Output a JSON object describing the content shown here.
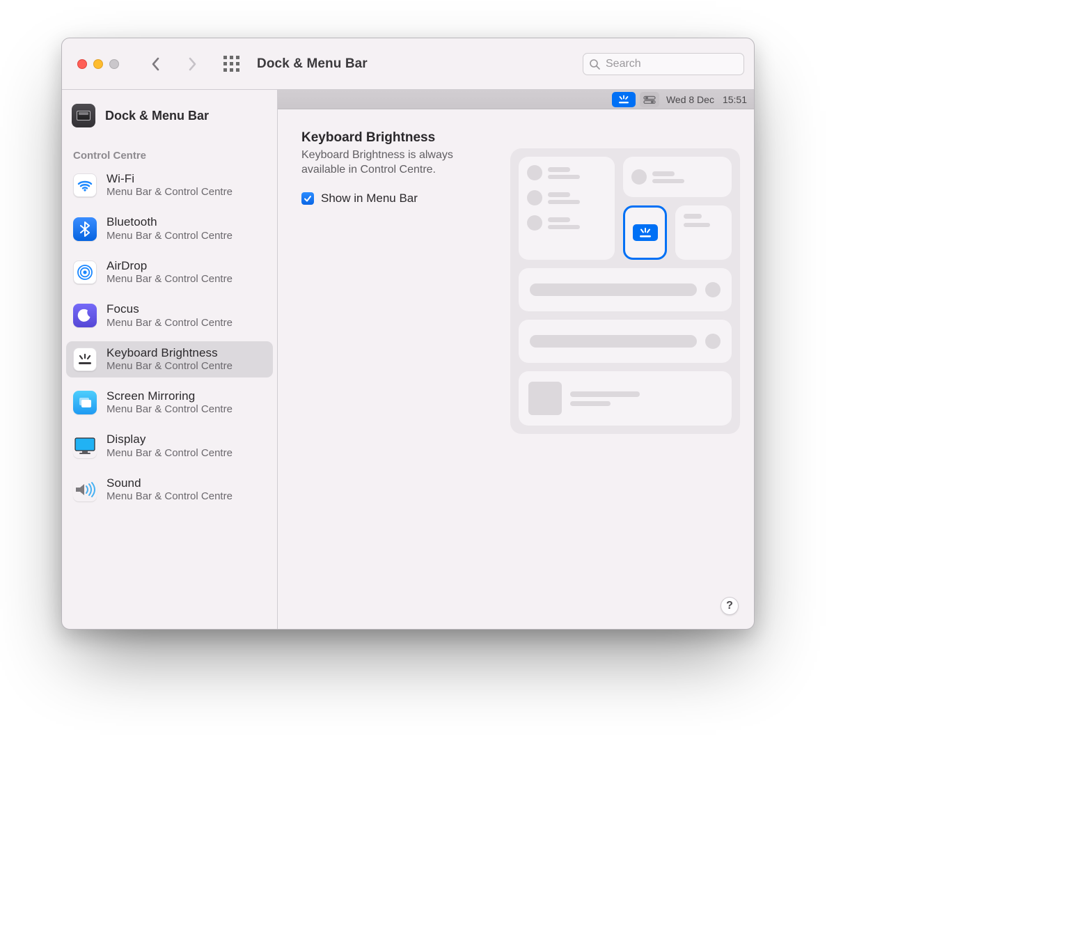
{
  "toolbar": {
    "title": "Dock & Menu Bar",
    "search_placeholder": "Search"
  },
  "sidebar": {
    "header": "Dock & Menu Bar",
    "section": "Control Centre",
    "items": [
      {
        "label": "Wi-Fi",
        "sub": "Menu Bar & Control Centre"
      },
      {
        "label": "Bluetooth",
        "sub": "Menu Bar & Control Centre"
      },
      {
        "label": "AirDrop",
        "sub": "Menu Bar & Control Centre"
      },
      {
        "label": "Focus",
        "sub": "Menu Bar & Control Centre"
      },
      {
        "label": "Keyboard Brightness",
        "sub": "Menu Bar & Control Centre"
      },
      {
        "label": "Screen Mirroring",
        "sub": "Menu Bar & Control Centre"
      },
      {
        "label": "Display",
        "sub": "Menu Bar & Control Centre"
      },
      {
        "label": "Sound",
        "sub": "Menu Bar & Control Centre"
      }
    ]
  },
  "menubar_preview": {
    "date": "Wed 8 Dec",
    "time": "15:51"
  },
  "main": {
    "title": "Keyboard Brightness",
    "description": "Keyboard Brightness is always available in Control Centre.",
    "checkbox_label": "Show in Menu Bar",
    "checkbox_checked": true
  },
  "help_label": "?"
}
